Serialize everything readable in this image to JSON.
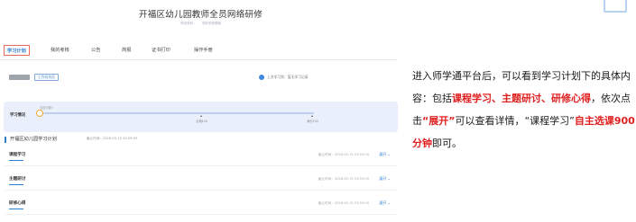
{
  "site": {
    "title": "开福区幼儿园教师全员网络研修",
    "sub_left": "学段学科：",
    "sub_right": "学前学前教育"
  },
  "nav": {
    "items": [
      "学习计划",
      "我的考核",
      "公告",
      "简报",
      "证书打印",
      "操作手册"
    ],
    "active_index": 0
  },
  "user": {
    "tag": "工作坊坊员",
    "learn_text": "上次学习到：暂无学习记录"
  },
  "progress": {
    "label": "学习情况",
    "current": "当前分数0",
    "fill_fraction": 0.0,
    "marks": [
      {
        "label": "合格100",
        "fraction": 0.585
      },
      {
        "label": "满分100",
        "fraction": 0.995
      }
    ]
  },
  "plan": {
    "title": "开福区幼儿园学习计划",
    "deadline": "截止时间：2026-05-15 23:59:59"
  },
  "sections": [
    {
      "name": "课程学习",
      "deadline": "截止时间：2026-05-15 23:59:00",
      "expand": "展开 ⌄"
    },
    {
      "name": "主题研讨",
      "deadline": "截止时间：2026-05-15 23:59:00",
      "expand": "展开 ⌄"
    },
    {
      "name": "研修心得",
      "deadline": "截止时间：2026-05-15 23:59:00",
      "expand": "展开 ⌄"
    }
  ],
  "description": {
    "t1": "进入师学通平台后，可以看到学习计划下的具体内容：包括",
    "h1": "课程学习、主题研讨、研修心得",
    "t2": "，依次点击",
    "h2": "“展开”",
    "t3": "可以查看详情，“课程学习”",
    "h3": "自主选课900分钟",
    "t4": "即可。"
  },
  "colors": {
    "accent": "#2f7fd1",
    "highlight": "#e02020",
    "active_border": "#e46a5c",
    "progress_bg": "#eaf0fb"
  }
}
